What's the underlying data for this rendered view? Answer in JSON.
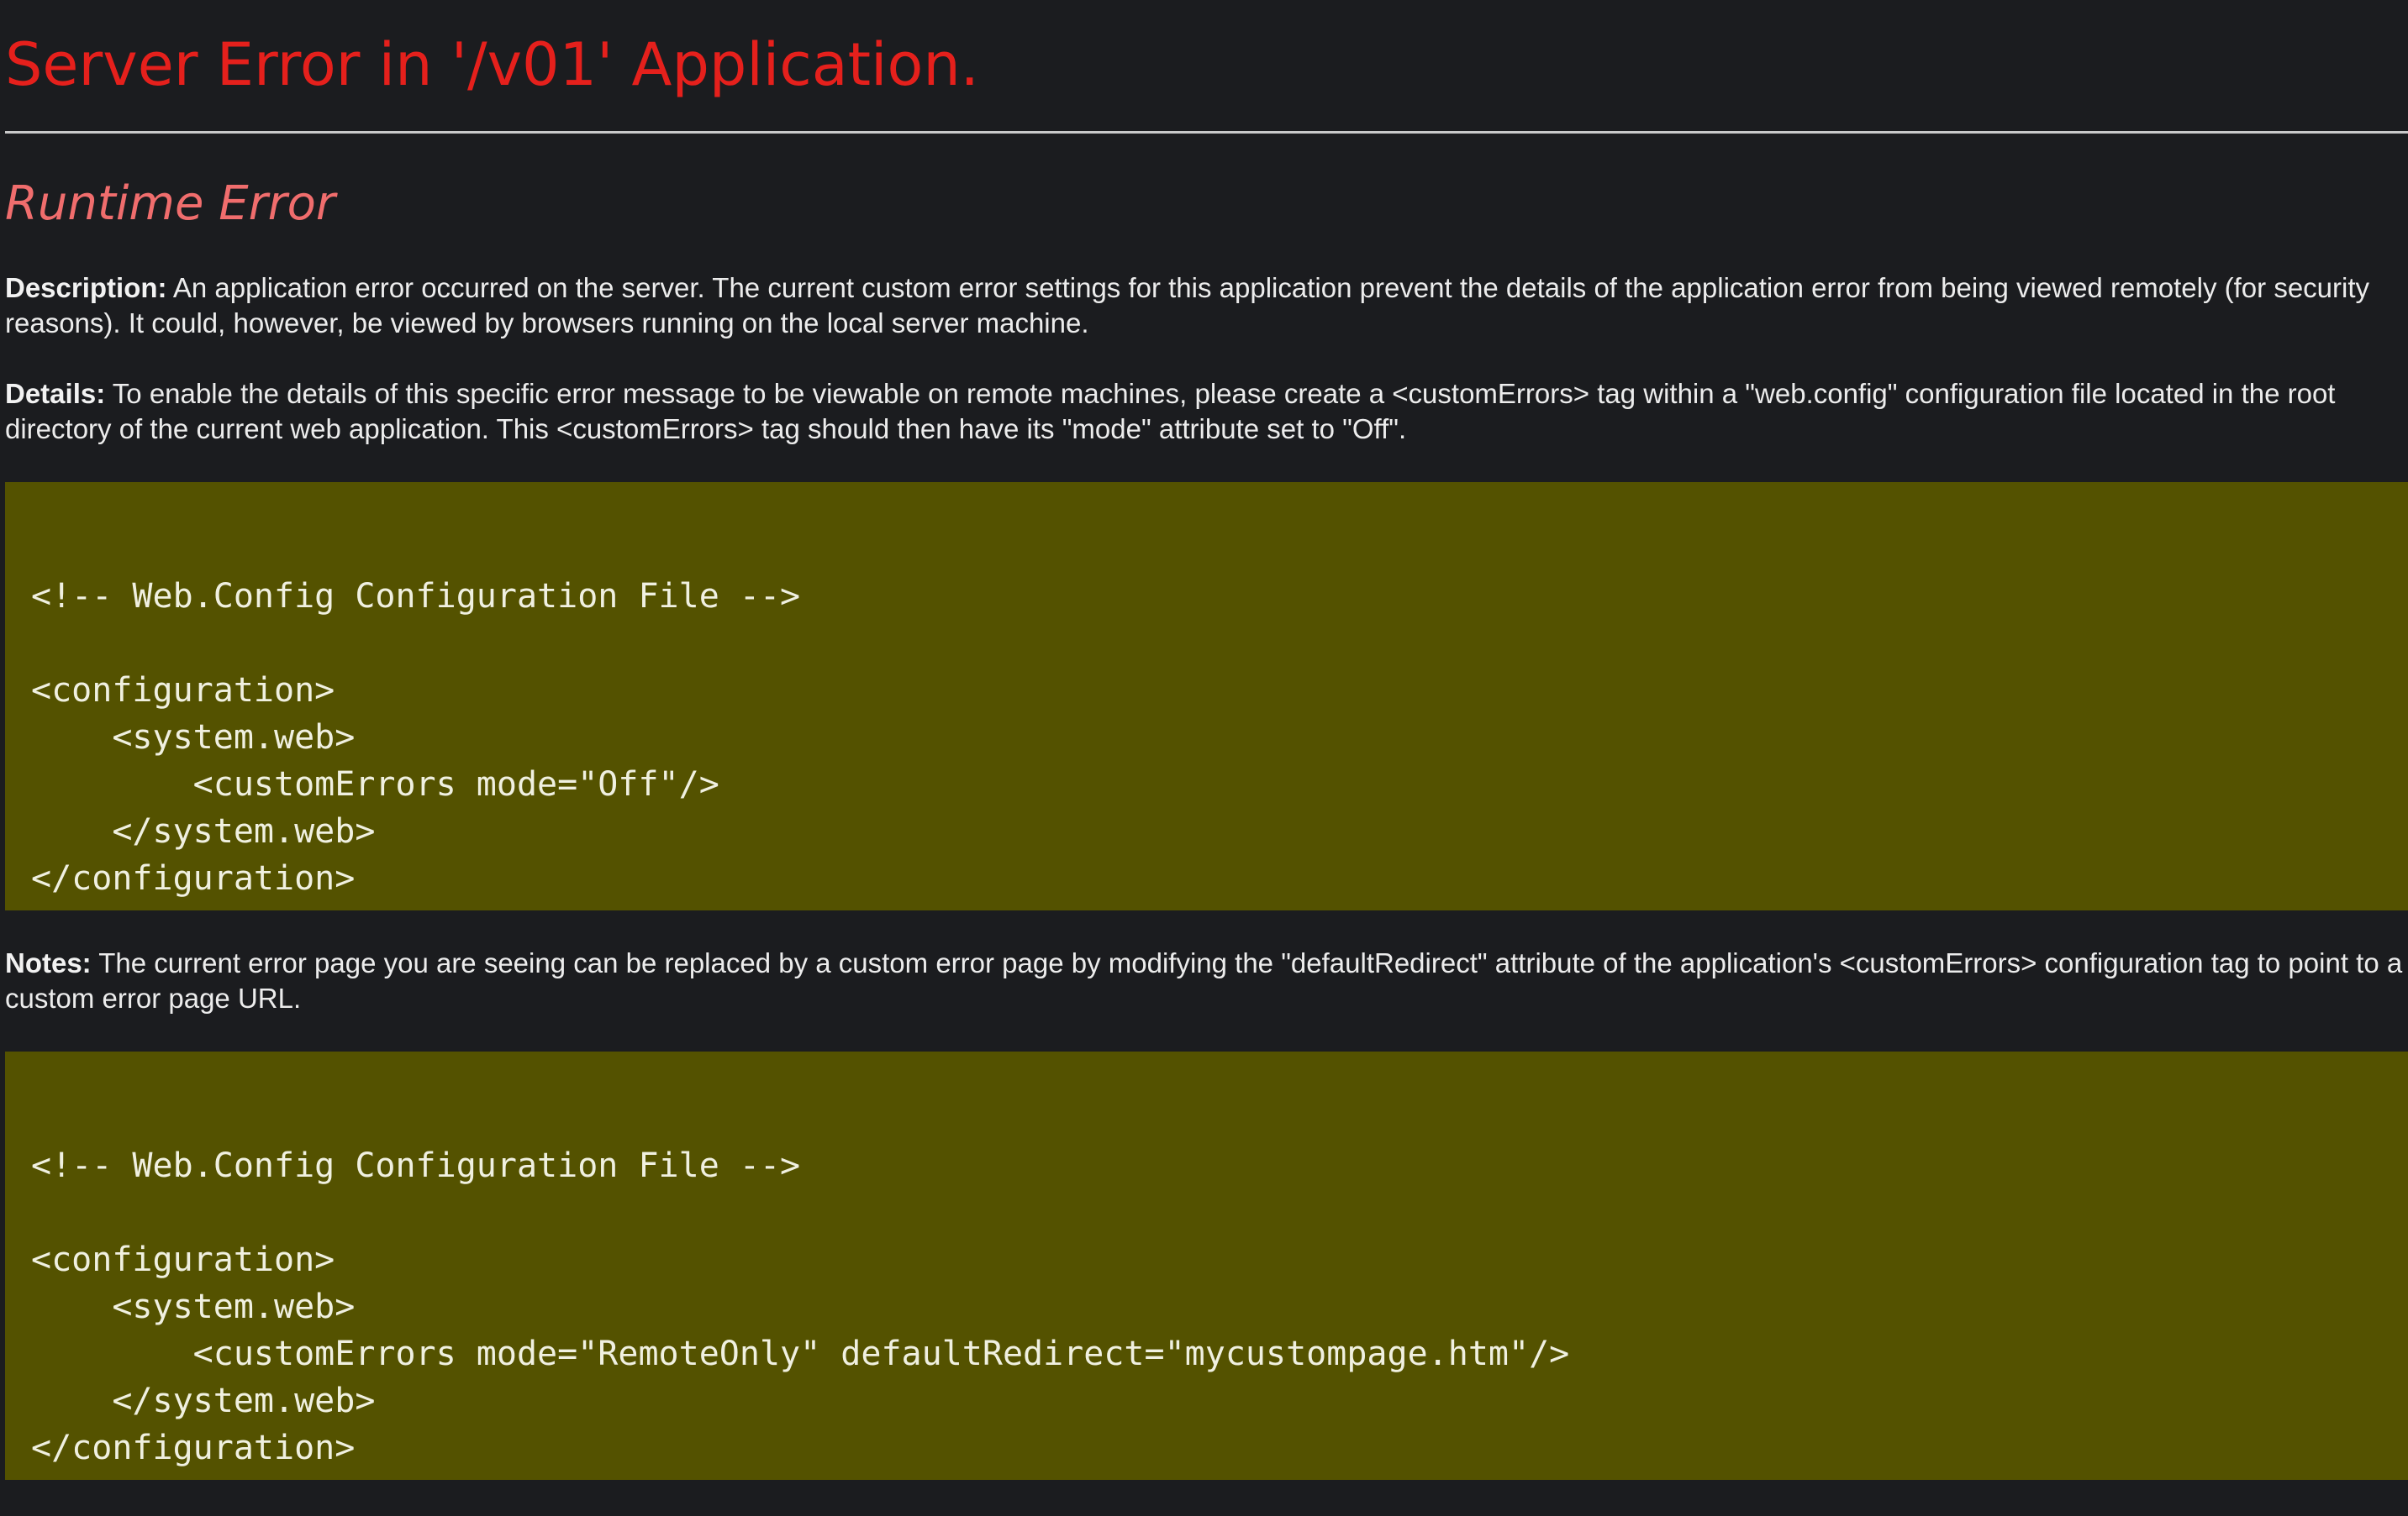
{
  "page": {
    "title": "Server Error in '/v01' Application.",
    "subtitle": "Runtime Error",
    "description": {
      "label": "Description:",
      "text": " An application error occurred on the server. The current custom error settings for this application prevent the details of the application error from being viewed remotely (for security reasons). It could, however, be viewed by browsers running on the local server machine."
    },
    "details": {
      "label": "Details:",
      "text": " To enable the details of this specific error message to be viewable on remote machines, please create a <customErrors> tag within a \"web.config\" configuration file located in the root directory of the current web application. This <customErrors> tag should then have its \"mode\" attribute set to \"Off\"."
    },
    "code_block_1": {
      "lines": [
        "",
        "<!-- Web.Config Configuration File -->",
        "",
        "<configuration>",
        "    <system.web>",
        "        <customErrors mode=\"Off\"/>",
        "    </system.web>",
        "</configuration>"
      ]
    },
    "notes": {
      "label": "Notes:",
      "text": " The current error page you are seeing can be replaced by a custom error page by modifying the \"defaultRedirect\" attribute of the application's <customErrors> configuration tag to point to a custom error page URL."
    },
    "code_block_2": {
      "lines": [
        "",
        "<!-- Web.Config Configuration File -->",
        "",
        "<configuration>",
        "    <system.web>",
        "        <customErrors mode=\"RemoteOnly\" defaultRedirect=\"mycustompage.htm\"/>",
        "    </system.web>",
        "</configuration>"
      ]
    }
  },
  "colors": {
    "background": "#1b1c1f",
    "title": "#e5201c",
    "subtitle": "#f06d6d",
    "text": "#ececec",
    "code_background": "#545200",
    "code_text": "#f0f0e0",
    "rule": "#c9c9c9"
  }
}
